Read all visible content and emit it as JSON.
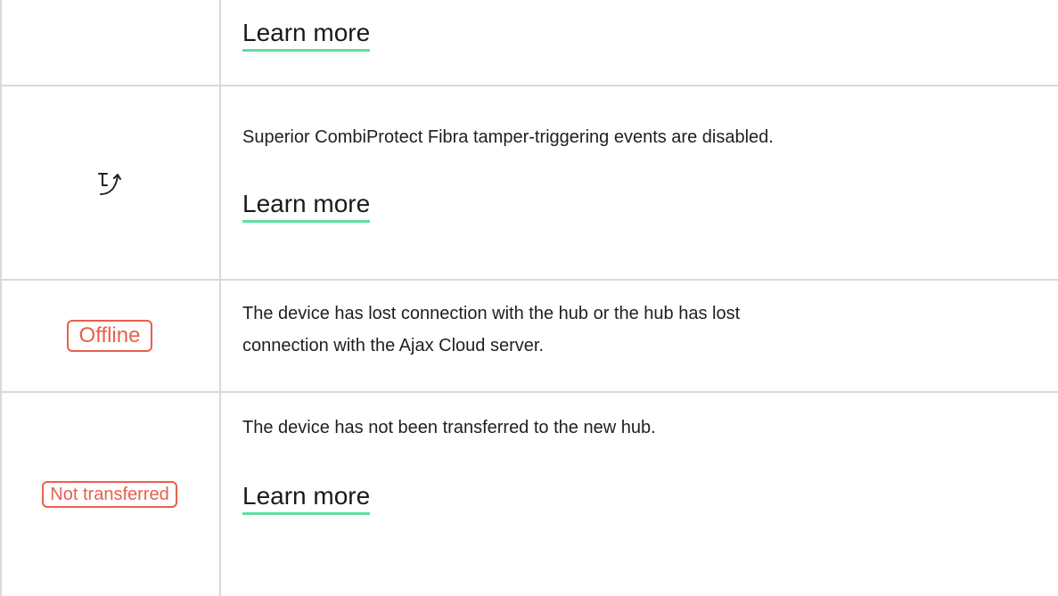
{
  "rows": [
    {
      "link_label": "Learn more"
    },
    {
      "icon": "tamper-disabled-icon",
      "description": "Superior CombiProtect Fibra tamper-triggering events are disabled.",
      "link_label": "Learn more"
    },
    {
      "badge": "Offline",
      "description_line1": "The device has lost connection with the hub or the hub has lost",
      "description_line2": "connection with the Ajax Cloud server."
    },
    {
      "badge": "Not transferred",
      "description": "The device has not been transferred to the new hub.",
      "link_label": "Learn more"
    }
  ],
  "colors": {
    "badge": "#e8604c",
    "link_underline": "#5fe0a3",
    "grid": "#d9d9d9"
  }
}
